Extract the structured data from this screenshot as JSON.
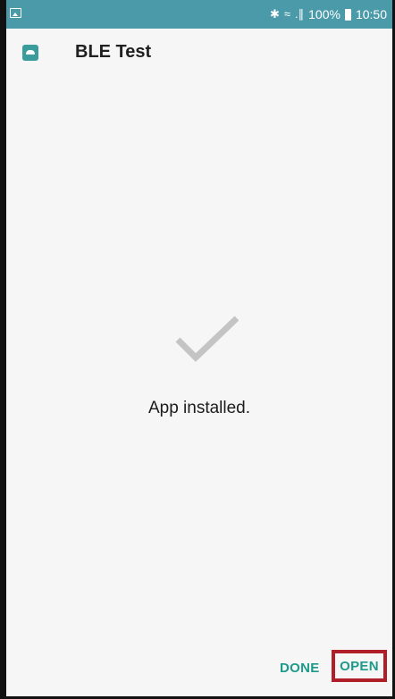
{
  "status_bar": {
    "left_icon": "image-icon",
    "bluetooth_glyph": "✱",
    "wifi_glyph": "≈",
    "signal_glyph": ".∥",
    "battery_percent": "100%",
    "time": "10:50",
    "color": "#4a9aa9"
  },
  "header": {
    "app_icon": "android-app-icon",
    "title": "BLE Test"
  },
  "content": {
    "status_icon": "checkmark-icon",
    "message": "App installed."
  },
  "buttons": {
    "done_label": "DONE",
    "open_label": "OPEN",
    "accent_color": "#1d9a8a",
    "highlight_color": "#b01e2a"
  }
}
